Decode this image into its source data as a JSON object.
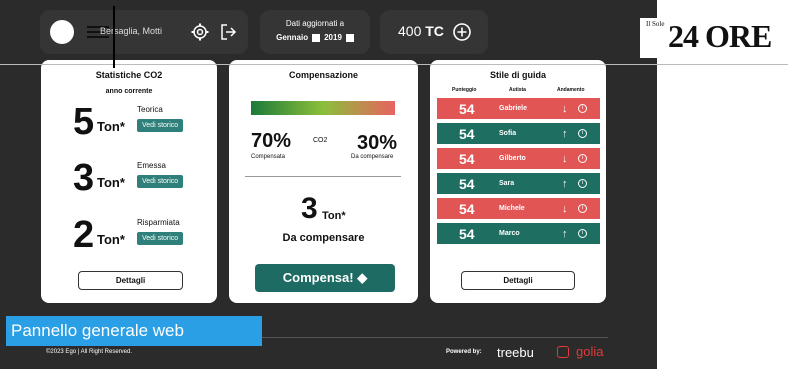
{
  "header": {
    "user_name": "Bersaglia, Motti",
    "date_title": "Dati aggiornati a",
    "date_month": "Gennaio",
    "date_year": "2019",
    "tc_value": "400",
    "tc_unit": "TC"
  },
  "card_stats": {
    "title": "Statistiche CO2",
    "subtitle": "anno corrente",
    "items": [
      {
        "value": "5",
        "unit": "Ton*",
        "label": "Teorica",
        "link": "Vedi storico"
      },
      {
        "value": "3",
        "unit": "Ton*",
        "label": "Emessa",
        "link": "Vedi storico"
      },
      {
        "value": "2",
        "unit": "Ton*",
        "label": "Risparmiata",
        "link": "Vedi storico"
      }
    ],
    "details_button": "Dettagli"
  },
  "card_comp": {
    "title": "Compensazione",
    "compensated_pct": "70%",
    "compensated_label": "Compensata",
    "co2_label": "CO2",
    "to_compensate_pct": "30%",
    "to_compensate_label": "Da compensare",
    "big_value": "3",
    "big_unit": "Ton*",
    "big_label": "Da compensare",
    "button": "Compensa!"
  },
  "card_guide": {
    "title": "Stile di guida",
    "headers": [
      "Punteggio",
      "Autista",
      "Andamento"
    ],
    "drivers": [
      {
        "score": "54",
        "name": "Gabriele",
        "trend": "down",
        "color": "#e25555"
      },
      {
        "score": "54",
        "name": "Sofia",
        "trend": "up",
        "color": "#1f6e62"
      },
      {
        "score": "54",
        "name": "Gilberto",
        "trend": "down",
        "color": "#e25555"
      },
      {
        "score": "54",
        "name": "Sara",
        "trend": "up",
        "color": "#1f6e62"
      },
      {
        "score": "54",
        "name": "Michele",
        "trend": "down",
        "color": "#e25555"
      },
      {
        "score": "54",
        "name": "Marco",
        "trend": "up",
        "color": "#1f6e62"
      }
    ],
    "details_button": "Dettagli"
  },
  "banner": "Pannello generale web",
  "footer": {
    "copyright": "©2023 Ego | All Right Reserved.",
    "powered_by": "Powered by:",
    "treebu": "treebu",
    "golia": "golia"
  },
  "logo": {
    "small": "Il Sole",
    "big": "24 ORE"
  }
}
